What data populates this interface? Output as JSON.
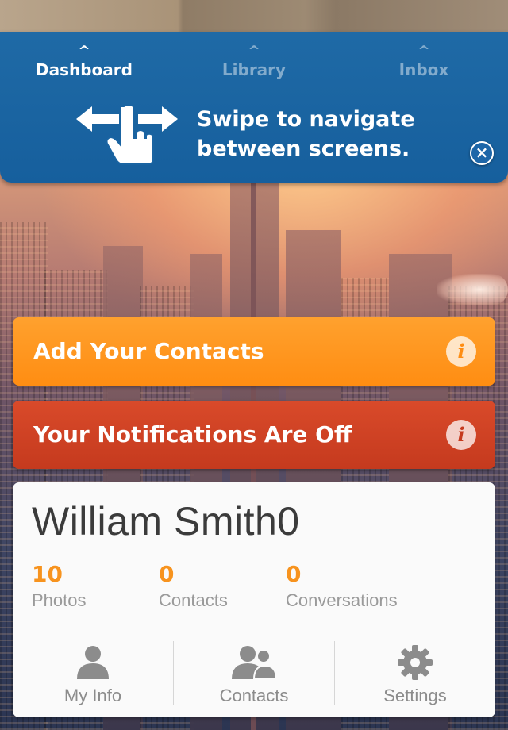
{
  "tutorial": {
    "tabs": [
      {
        "label": "Dashboard",
        "active": true
      },
      {
        "label": "Library",
        "active": false
      },
      {
        "label": "Inbox",
        "active": false
      }
    ],
    "message_line1": "Swipe to navigate",
    "message_line2": "between screens.",
    "close_symbol": "×",
    "icon": "swipe-gesture-icon"
  },
  "banners": {
    "add_contacts": {
      "label": "Add Your Contacts",
      "info_symbol": "i",
      "color": "#ff9a1f"
    },
    "notifications": {
      "label": "Your Notifications Are Off",
      "info_symbol": "i",
      "color": "#c9401f"
    }
  },
  "profile": {
    "name": "William Smith0",
    "stats": [
      {
        "value": "10",
        "label": "Photos"
      },
      {
        "value": "0",
        "label": "Contacts"
      },
      {
        "value": "0",
        "label": "Conversations"
      }
    ],
    "actions": [
      {
        "label": "My Info",
        "icon": "person-icon"
      },
      {
        "label": "Contacts",
        "icon": "people-icon"
      },
      {
        "label": "Settings",
        "icon": "gear-icon"
      }
    ]
  },
  "colors": {
    "panel_blue": "#1a64a2",
    "accent_orange": "#f7931e",
    "text_gray": "#8c8c8c"
  }
}
